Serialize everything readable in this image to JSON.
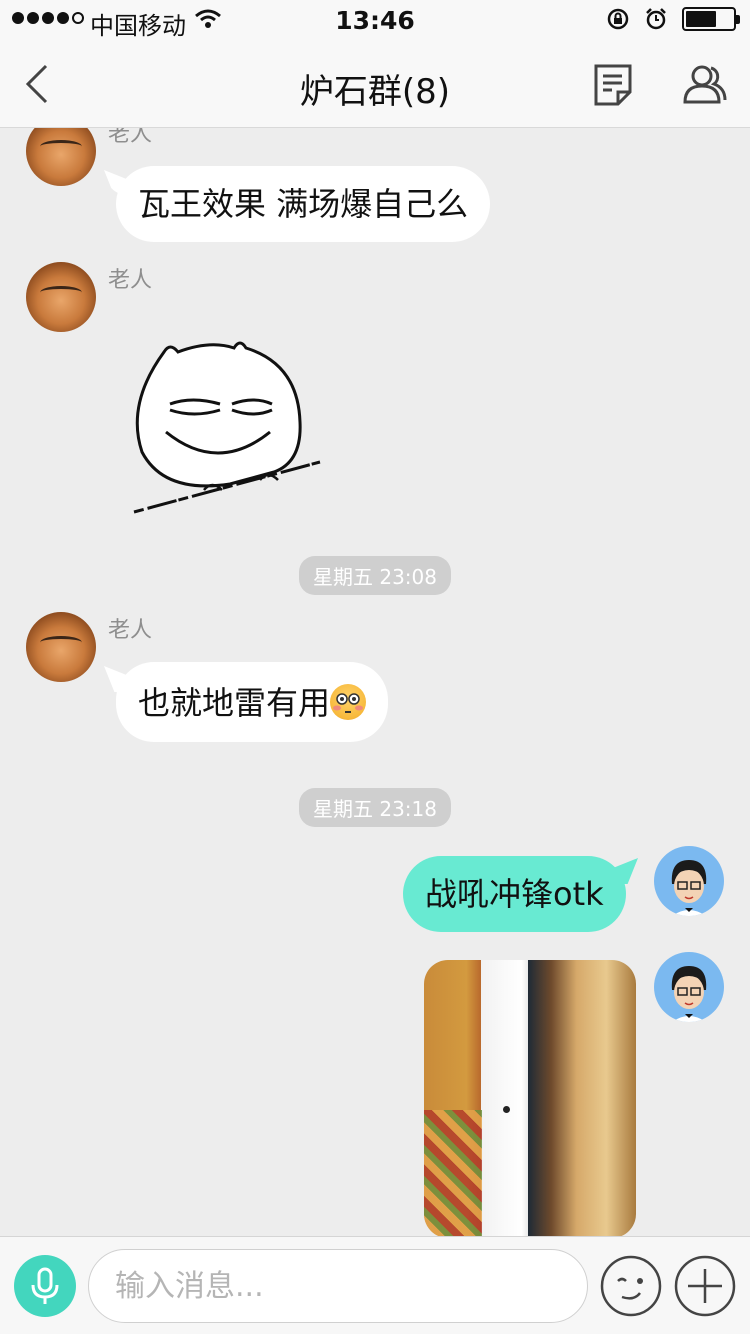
{
  "status_bar": {
    "carrier": "中国移动",
    "time": "13:46",
    "battery_level": 0.65
  },
  "nav": {
    "title": "炉石群(8)",
    "back_icon": "chevron-left-icon",
    "notes_icon": "note-icon",
    "members_icon": "members-icon"
  },
  "messages": [
    {
      "sender": "老人",
      "text": "瓦王效果 满场爆自己么"
    },
    {
      "sender": "老人",
      "sticker": "smug-face-sticker"
    },
    {
      "timestamp": "星期五 23:08"
    },
    {
      "sender": "老人",
      "text": "也就地雷有用",
      "emoji": "flushed-face-emoji"
    },
    {
      "timestamp": "星期五 23:18"
    },
    {
      "own": true,
      "text": "战吼冲锋otk"
    },
    {
      "own": true,
      "image": "photo-of-phone-hearthstone"
    }
  ],
  "input": {
    "placeholder": "输入消息...",
    "mic_icon": "microphone-icon",
    "emoji_icon": "wink-emoji-icon",
    "plus_icon": "plus-icon"
  },
  "colors": {
    "own_bubble": "#68ead2",
    "accent": "#43d6be",
    "background": "#ededed"
  }
}
